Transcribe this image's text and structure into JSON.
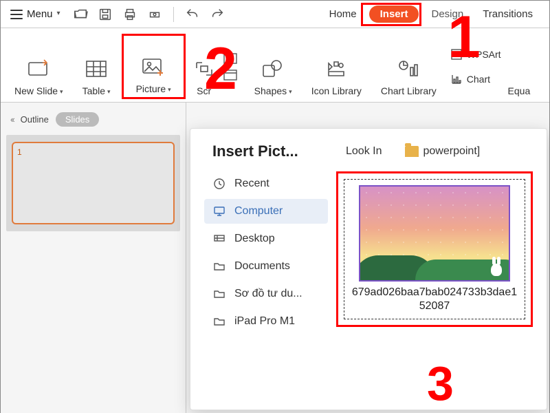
{
  "menu": {
    "label": "Menu"
  },
  "tabs": {
    "home": "Home",
    "insert": "Insert",
    "design": "Design",
    "transitions": "Transitions"
  },
  "ribbon": {
    "new_slide": "New Slide",
    "table": "Table",
    "picture": "Picture",
    "screenshot": "Scr",
    "shapes": "Shapes",
    "icon_library": "Icon Library",
    "chart_library": "Chart Library",
    "chart": "Chart",
    "equation": "Equa",
    "wpsart": "WPSArt"
  },
  "leftpane": {
    "outline": "Outline",
    "slides": "Slides",
    "slide_number": "1"
  },
  "dialog": {
    "title_full": "Insert Picture",
    "title": "Insert Pict...",
    "look_in": "Look In",
    "folder": "powerpoint]",
    "sources": {
      "recent": "Recent",
      "computer": "Computer",
      "desktop": "Desktop",
      "documents": "Documents",
      "sodo": "Sơ đồ tư du...",
      "ipad": "iPad Pro M1"
    },
    "file_name": "679ad026baa7bab024733b3dae152087"
  },
  "annotations": {
    "step1": "1",
    "step2": "2",
    "step3": "3"
  }
}
